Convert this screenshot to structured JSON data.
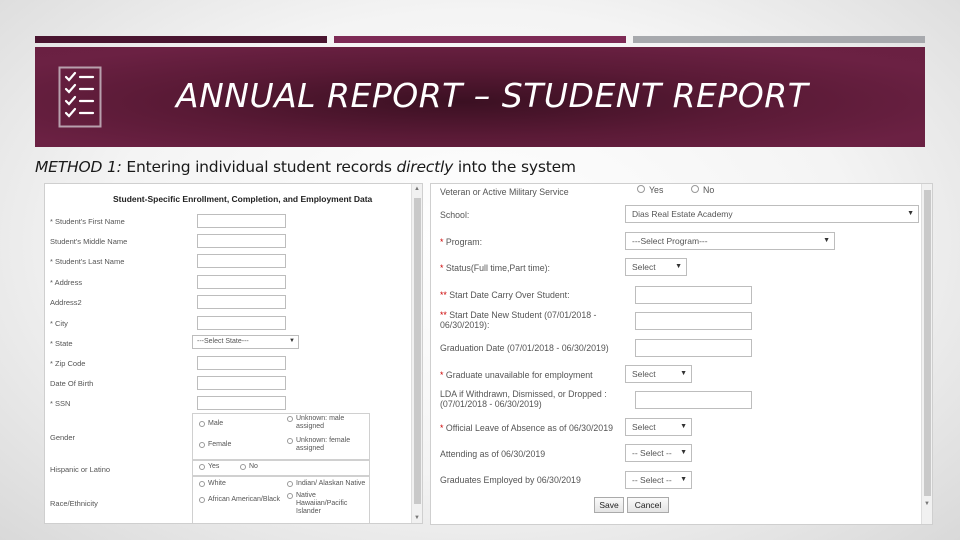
{
  "slide": {
    "title": "ANNUAL REPORT – STUDENT REPORT",
    "subtitle_prefix": "METHOD 1:",
    "subtitle_text_1": "Entering individual student records",
    "subtitle_emphasis": "directly",
    "subtitle_text_2": "into the system",
    "colors": {
      "banner": "#5a1a36",
      "bar1": "#4a1530",
      "bar2": "#7d2a55",
      "bar3": "#a7a9ad"
    },
    "icon": "checklist-icon"
  },
  "left_form": {
    "heading": "Student-Specific Enrollment, Completion, and Employment Data",
    "fields": {
      "first_name": "* Student's First Name",
      "middle_name": "Student's Middle Name",
      "last_name": "* Student's Last Name",
      "address": "* Address",
      "address2": "Address2",
      "city": "* City",
      "state": "* State",
      "zip": "* Zip Code",
      "dob": "Date Of Birth",
      "ssn": "* SSN",
      "gender": "Gender",
      "hispanic": "Hispanic or Latino",
      "race": "Race/Ethnicity"
    },
    "state_placeholder": "---Select State---",
    "gender_options": {
      "male": "Male",
      "female": "Female",
      "unknown_male": "Unknown: male assigned",
      "unknown_female": "Unknown: female assigned"
    },
    "hispanic_options": {
      "yes": "Yes",
      "no": "No"
    },
    "race_options": {
      "white": "White",
      "indian": "Indian/ Alaskan Native",
      "african": "African American/Black",
      "hawaiian": "Native Hawaiian/Pacific Islander"
    }
  },
  "right_form": {
    "veteran_label": "Veteran or Active Military Service",
    "veteran_yes": "Yes",
    "veteran_no": "No",
    "school_label": "School:",
    "school_value": "Dias Real Estate Academy",
    "program_label": "Program:",
    "program_value": "---Select Program---",
    "status_label": "Status(Full time,Part time):",
    "status_value": "Select",
    "carry_over_label": "Start Date Carry Over Student:",
    "new_student_label": "Start Date New Student (07/01/2018 - 06/30/2019):",
    "graduation_label": "Graduation Date (07/01/2018 - 06/30/2019)",
    "unavailable_label": "Graduate unavailable for employment",
    "unavailable_value": "Select",
    "lda_label": "LDA if Withdrawn, Dismissed, or Dropped : (07/01/2018 - 06/30/2019)",
    "leave_label": "Official Leave of Absence as of 06/30/2019",
    "leave_value": "Select",
    "attending_label": "Attending as of 06/30/2019",
    "attending_value": "-- Select --",
    "employed_label": "Graduates Employed by 06/30/2019",
    "employed_value": "-- Select --",
    "save_label": "Save",
    "cancel_label": "Cancel"
  }
}
